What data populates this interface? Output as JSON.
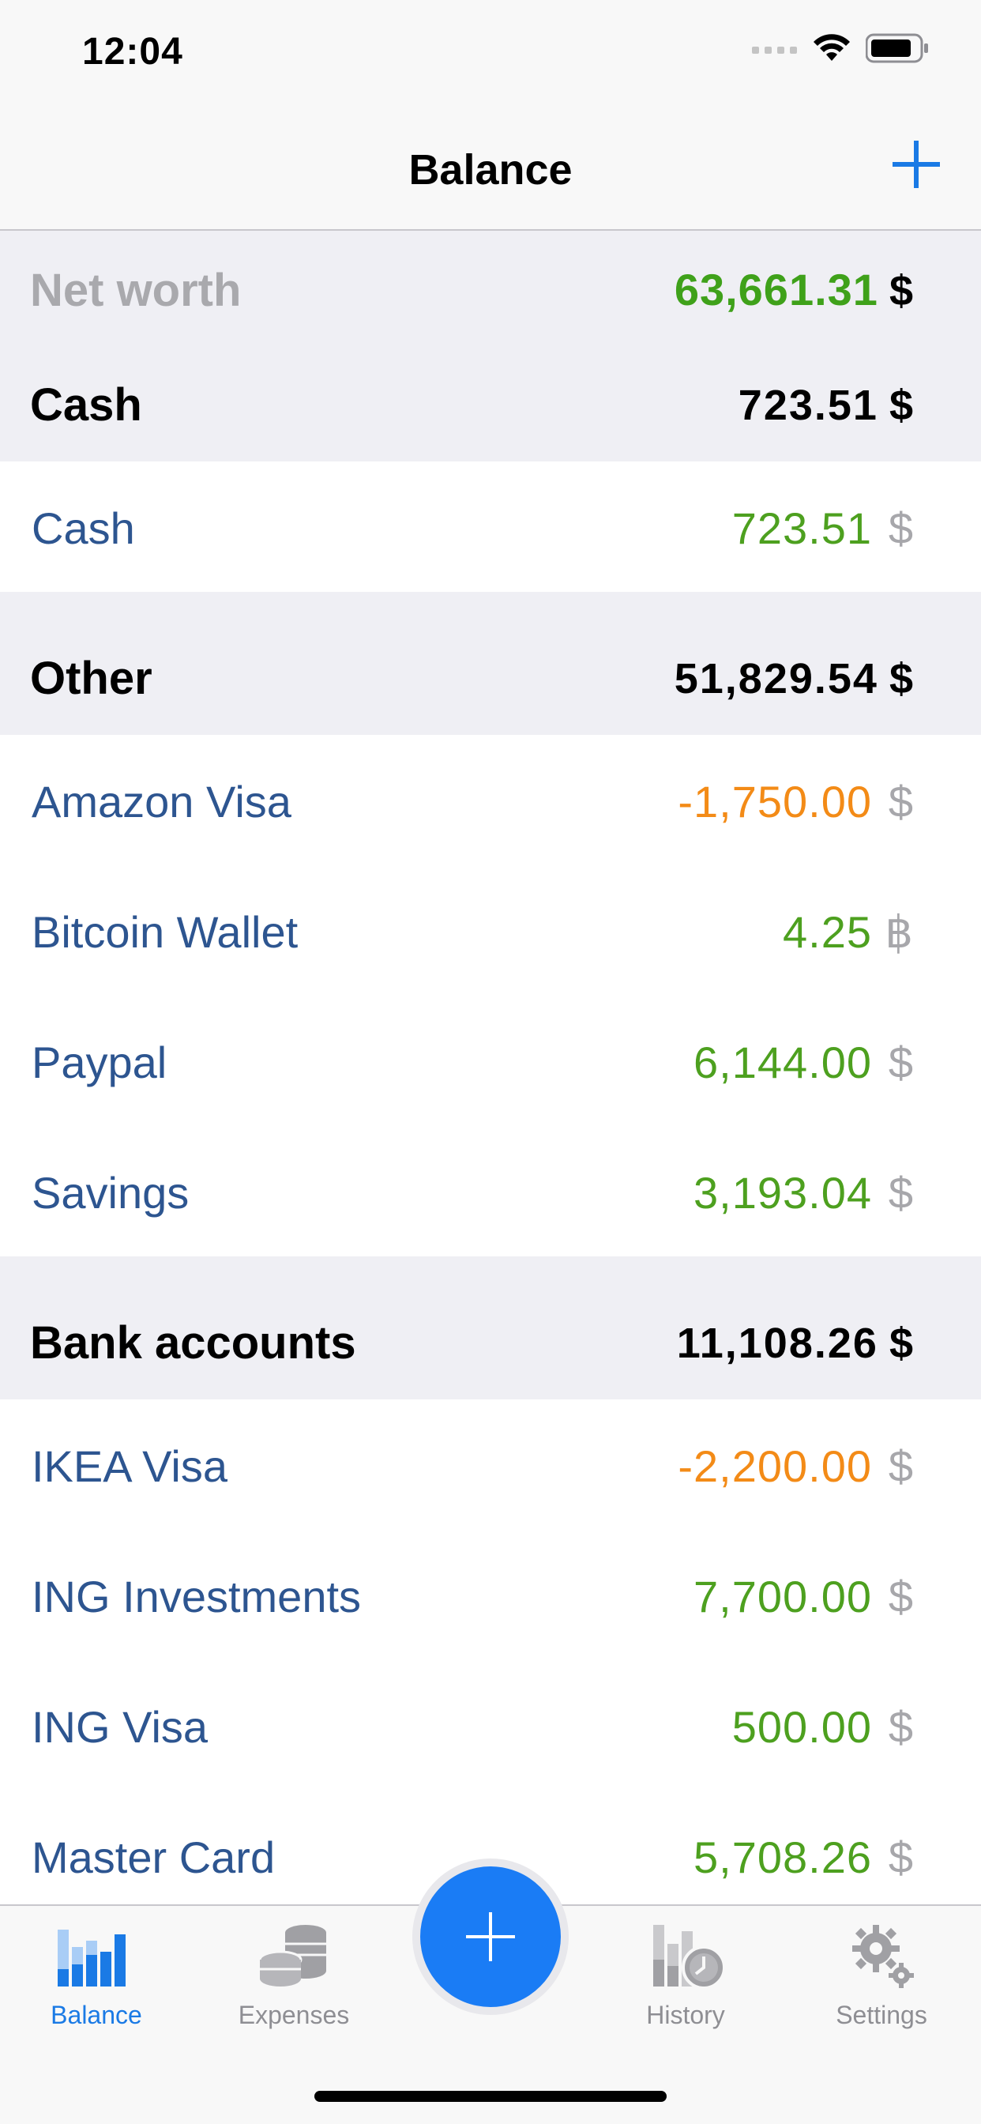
{
  "status_bar": {
    "time": "12:04"
  },
  "nav": {
    "title": "Balance"
  },
  "net_worth": {
    "label": "Net worth",
    "value": "63,661.31",
    "currency": "$"
  },
  "sections": [
    {
      "title": "Cash",
      "total": "723.51",
      "currency": "$",
      "accounts": [
        {
          "name": "Cash",
          "amount": "723.51",
          "currency": "$",
          "sign": "pos"
        }
      ]
    },
    {
      "title": "Other",
      "total": "51,829.54",
      "currency": "$",
      "accounts": [
        {
          "name": "Amazon Visa",
          "amount": "-1,750.00",
          "currency": "$",
          "sign": "neg"
        },
        {
          "name": "Bitcoin Wallet",
          "amount": "4.25",
          "currency": "฿",
          "sign": "pos"
        },
        {
          "name": "Paypal",
          "amount": "6,144.00",
          "currency": "$",
          "sign": "pos"
        },
        {
          "name": "Savings",
          "amount": "3,193.04",
          "currency": "$",
          "sign": "pos"
        }
      ]
    },
    {
      "title": "Bank accounts",
      "total": "11,108.26",
      "currency": "$",
      "accounts": [
        {
          "name": "IKEA Visa",
          "amount": "-2,200.00",
          "currency": "$",
          "sign": "neg"
        },
        {
          "name": "ING Investments",
          "amount": "7,700.00",
          "currency": "$",
          "sign": "pos"
        },
        {
          "name": "ING Visa",
          "amount": "500.00",
          "currency": "$",
          "sign": "pos"
        },
        {
          "name": "Master Card",
          "amount": "5,708.26",
          "currency": "$",
          "sign": "pos"
        }
      ]
    }
  ],
  "tabs": [
    {
      "label": "Balance",
      "icon": "bar-chart-icon",
      "active": true
    },
    {
      "label": "Expenses",
      "icon": "coins-icon",
      "active": false
    },
    {
      "label": "History",
      "icon": "history-icon",
      "active": false
    },
    {
      "label": "Settings",
      "icon": "gear-icon",
      "active": false
    }
  ],
  "colors": {
    "accent": "#1a7ae5",
    "positive": "#4da01f",
    "negative": "#f38b17",
    "account_name": "#2d5590",
    "section_bg": "#efeff4"
  }
}
